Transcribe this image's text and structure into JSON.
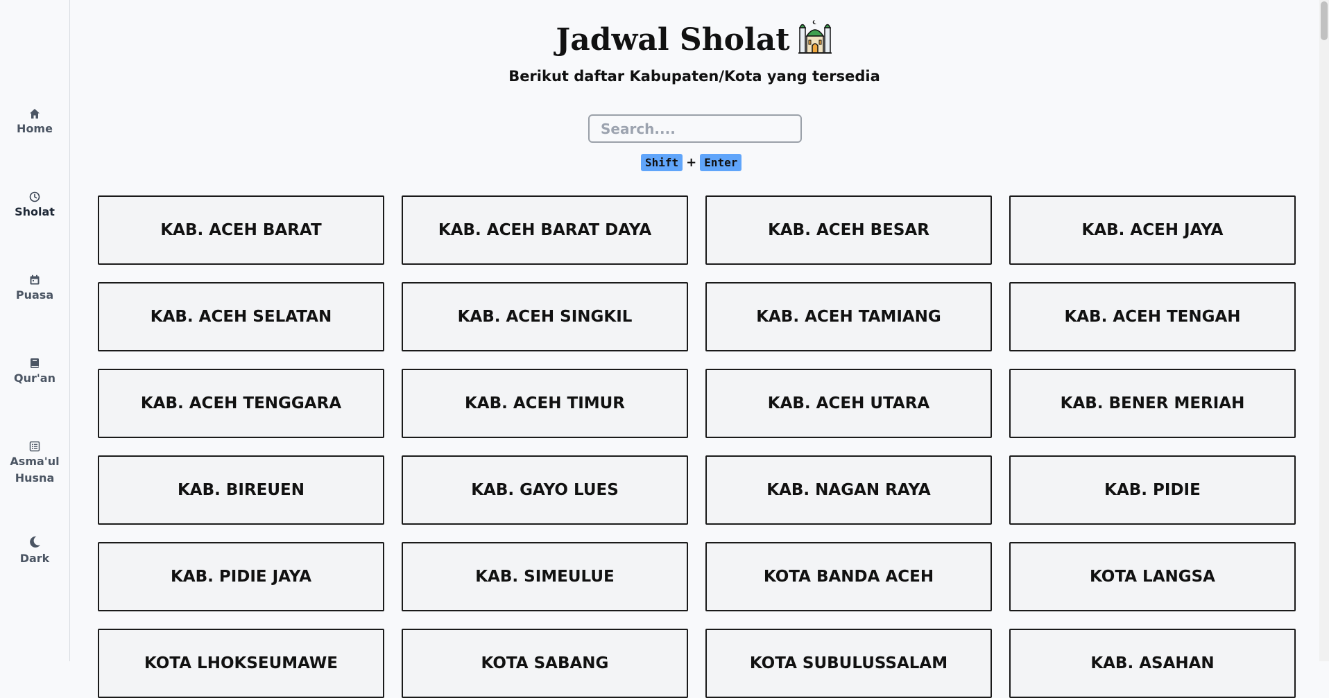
{
  "sidebar": {
    "items": [
      {
        "label": "Home",
        "icon": "home-icon"
      },
      {
        "label": "Sholat",
        "icon": "clock-icon"
      },
      {
        "label": "Puasa",
        "icon": "calendar-icon"
      },
      {
        "label": "Qur'an",
        "icon": "book-icon"
      },
      {
        "label": "Asma'ul Husna",
        "icon": "list-icon"
      },
      {
        "label": "Dark",
        "icon": "moon-icon"
      }
    ]
  },
  "header": {
    "title": "Jadwal Sholat",
    "subtitle": "Berikut daftar Kabupaten/Kota yang tersedia"
  },
  "search": {
    "placeholder": "Search....",
    "value": "",
    "shortcut_key1": "Shift",
    "shortcut_plus": "+",
    "shortcut_key2": "Enter"
  },
  "regions": [
    "KAB. ACEH BARAT",
    "KAB. ACEH BARAT DAYA",
    "KAB. ACEH BESAR",
    "KAB. ACEH JAYA",
    "KAB. ACEH SELATAN",
    "KAB. ACEH SINGKIL",
    "KAB. ACEH TAMIANG",
    "KAB. ACEH TENGAH",
    "KAB. ACEH TENGGARA",
    "KAB. ACEH TIMUR",
    "KAB. ACEH UTARA",
    "KAB. BENER MERIAH",
    "KAB. BIREUEN",
    "KAB. GAYO LUES",
    "KAB. NAGAN RAYA",
    "KAB. PIDIE",
    "KAB. PIDIE JAYA",
    "KAB. SIMEULUE",
    "KOTA BANDA ACEH",
    "KOTA LANGSA",
    "KOTA LHOKSEUMAWE",
    "KOTA SABANG",
    "KOTA SUBULUSSALAM",
    "KAB. ASAHAN"
  ],
  "colors": {
    "accent_kbd": "#60a5fa",
    "card_bg": "#f3f4f6",
    "card_border": "#1a1a1a",
    "page_bg": "#f8f9fb"
  }
}
